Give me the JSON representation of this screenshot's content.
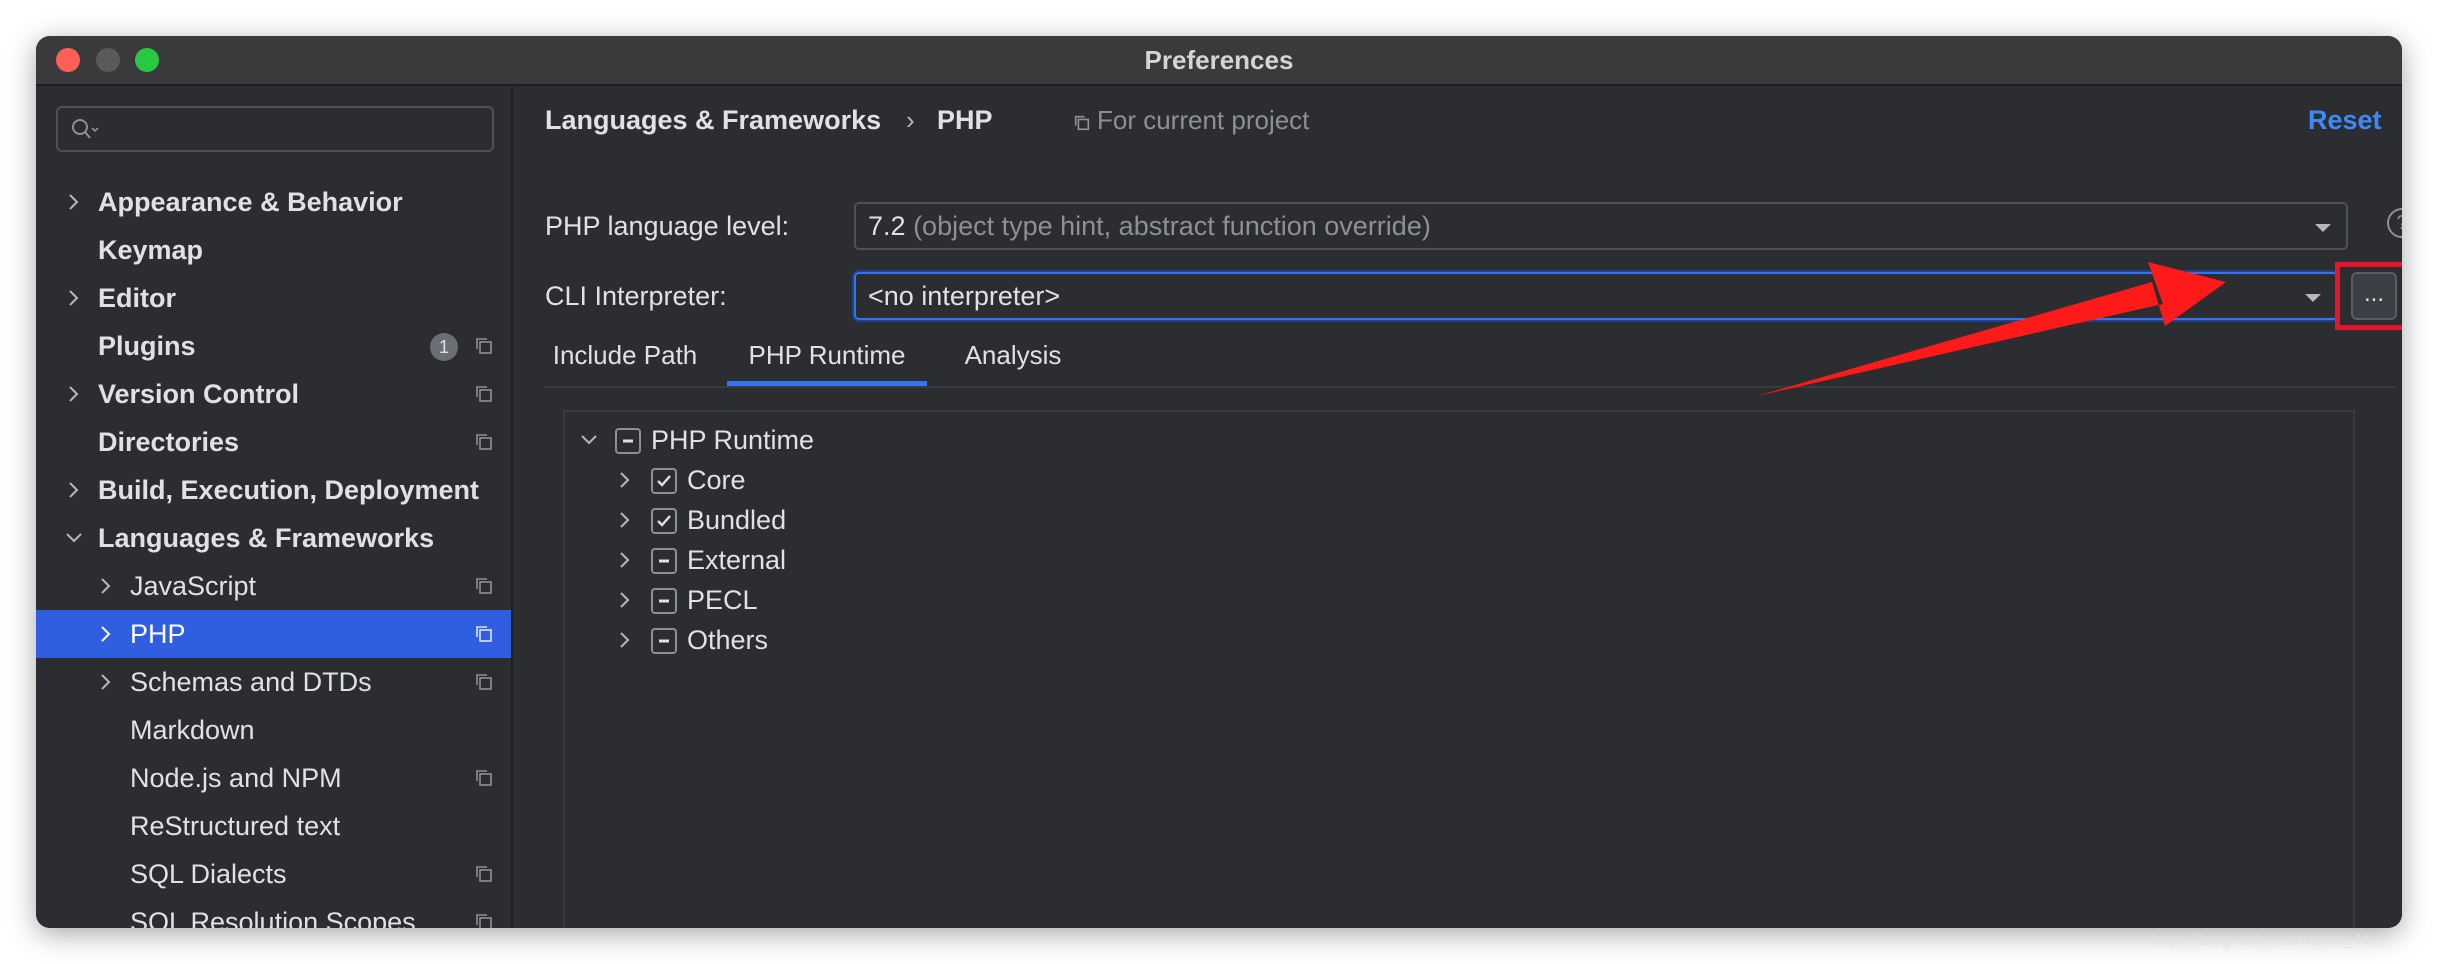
{
  "window": {
    "title": "Preferences"
  },
  "sidebar": {
    "search": {
      "value": "",
      "placeholder": ""
    },
    "items": [
      {
        "label": "Appearance & Behavior"
      },
      {
        "label": "Keymap"
      },
      {
        "label": "Editor"
      },
      {
        "label": "Plugins",
        "badge": "1"
      },
      {
        "label": "Version Control"
      },
      {
        "label": "Directories"
      },
      {
        "label": "Build, Execution, Deployment"
      },
      {
        "label": "Languages & Frameworks"
      },
      {
        "label": "JavaScript"
      },
      {
        "label": "PHP"
      },
      {
        "label": "Schemas and DTDs"
      },
      {
        "label": "Markdown"
      },
      {
        "label": "Node.js and NPM"
      },
      {
        "label": "ReStructured text"
      },
      {
        "label": "SQL Dialects"
      },
      {
        "label": "SQL Resolution Scopes"
      }
    ]
  },
  "header": {
    "breadcrumb_parent": "Languages & Frameworks",
    "breadcrumb_sep": "›",
    "breadcrumb_current": "PHP",
    "scope": "For current project",
    "reset_label": "Reset"
  },
  "php_level": {
    "label": "PHP language level:",
    "value": "7.2",
    "hint": "(object type hint, abstract function override)",
    "help": "?"
  },
  "cli": {
    "label": "CLI Interpreter:",
    "value": "<no interpreter>",
    "browse_label": "..."
  },
  "tabs": [
    {
      "label": "Include Path"
    },
    {
      "label": "PHP Runtime"
    },
    {
      "label": "Analysis"
    }
  ],
  "tree": {
    "root": "PHP Runtime",
    "children": [
      {
        "label": "Core",
        "checked": true
      },
      {
        "label": "Bundled",
        "checked": true
      },
      {
        "label": "External",
        "checked": "partial"
      },
      {
        "label": "PECL",
        "checked": "partial"
      },
      {
        "label": "Others",
        "checked": "partial"
      }
    ]
  },
  "colors": {
    "background": "#2b2d30",
    "selection": "#2f5ee0",
    "accent": "#3574f0",
    "link": "#3d8af7",
    "annotation": "#e8142a"
  }
}
